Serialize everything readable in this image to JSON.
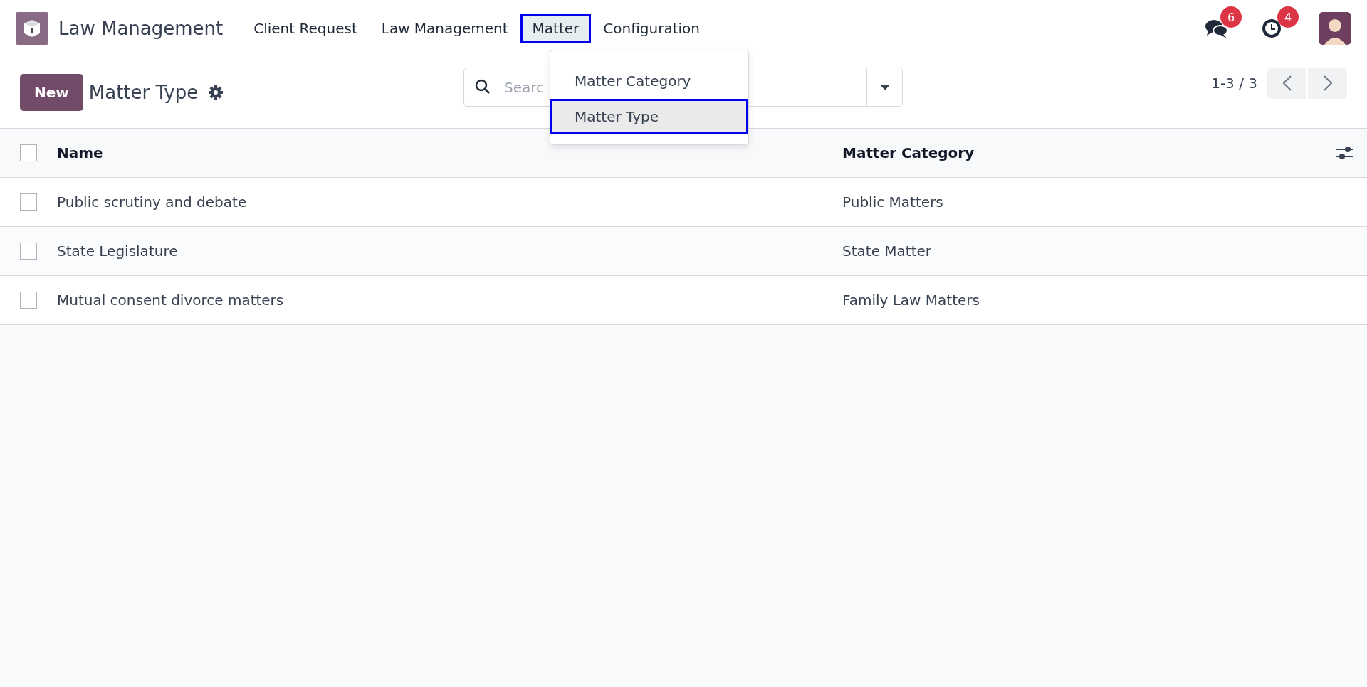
{
  "navbar": {
    "app_name": "Law Management",
    "menus": [
      {
        "label": "Client Request",
        "selected": false
      },
      {
        "label": "Law Management",
        "selected": false
      },
      {
        "label": "Matter",
        "selected": true
      },
      {
        "label": "Configuration",
        "selected": false
      }
    ],
    "messages_badge": "6",
    "activities_badge": "4"
  },
  "dropdown": {
    "items": [
      {
        "label": "Matter Category",
        "selected": false
      },
      {
        "label": "Matter Type",
        "selected": true
      }
    ]
  },
  "control_panel": {
    "new_button": "New",
    "title": "Matter Type",
    "search": {
      "placeholder": "Searc"
    },
    "pager": "1-3 / 3"
  },
  "table": {
    "all_checked": false,
    "columns": [
      "Name",
      "Matter Category"
    ],
    "rows": [
      {
        "name": "Public scrutiny and debate",
        "category": "Public Matters",
        "checked": false
      },
      {
        "name": "State Legislature",
        "category": "State Matter",
        "checked": false
      },
      {
        "name": "Mutual consent divorce matters",
        "category": "Family Law Matters",
        "checked": false
      }
    ]
  }
}
